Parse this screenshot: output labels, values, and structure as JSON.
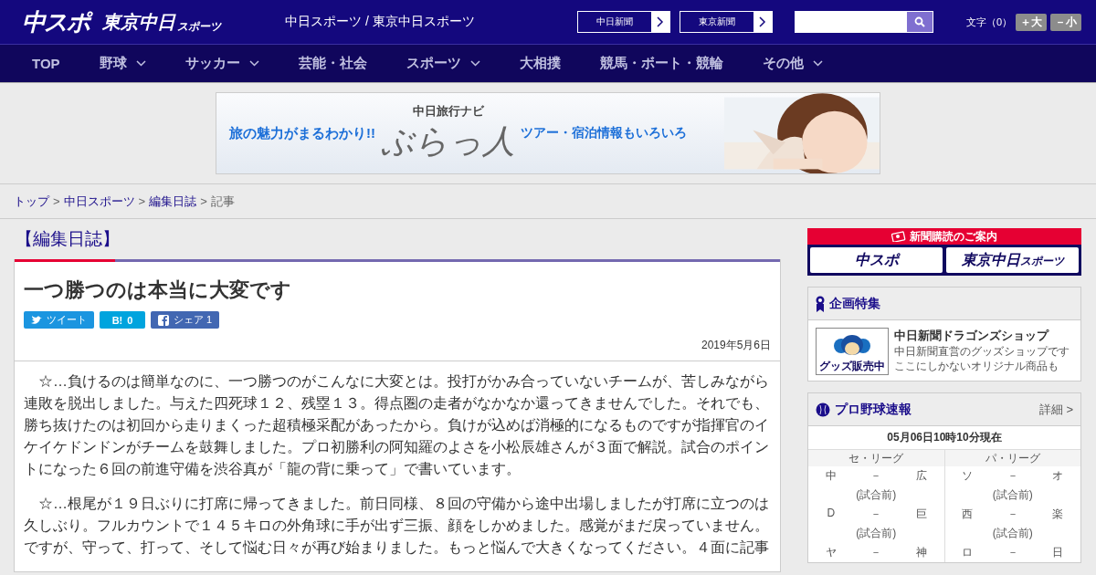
{
  "header": {
    "logo": "中スポ",
    "logo2": "東京中日",
    "logo2_small": "スポーツ",
    "site_names": "中日スポーツ / 東京中日スポーツ",
    "papers": [
      {
        "label": "中日新聞"
      },
      {
        "label": "東京新聞"
      }
    ],
    "font_size": {
      "label": "文字（0）",
      "buttons": [
        "＋大",
        "－小"
      ]
    }
  },
  "nav": [
    {
      "label": "TOP",
      "has_menu": false
    },
    {
      "label": "野球",
      "has_menu": true
    },
    {
      "label": "サッカー",
      "has_menu": true
    },
    {
      "label": "芸能・社会",
      "has_menu": false
    },
    {
      "label": "スポーツ",
      "has_menu": true
    },
    {
      "label": "大相撲",
      "has_menu": false
    },
    {
      "label": "競馬・ボート・競輪",
      "has_menu": false
    },
    {
      "label": "その他",
      "has_menu": true
    }
  ],
  "banner": {
    "lead": "旅の魅力がまるわかり!!",
    "brand_small": "中日旅行ナビ",
    "brand": "ぶらっ人",
    "tail": "ツアー・宿泊情報もいろいろ"
  },
  "breadcrumb": [
    {
      "label": "トップ",
      "link": true
    },
    {
      "sep": ">",
      "label": "中日スポーツ",
      "link": true
    },
    {
      "sep": ">",
      "label": "編集日誌",
      "link": true
    },
    {
      "sep": ">",
      "label": "記事",
      "link": false
    }
  ],
  "section_title": "【編集日誌】",
  "article": {
    "title": "一つ勝つのは本当に大変です",
    "share": [
      {
        "kind": "twitter",
        "label": "ツイート"
      },
      {
        "kind": "hatena",
        "icon_text": "B!",
        "label": "0"
      },
      {
        "kind": "facebook",
        "label": "シェア 1"
      }
    ],
    "date": "2019年5月6日",
    "paragraphs": [
      "☆…負けるのは簡単なのに、一つ勝つのがこんなに大変とは。投打がかみ合っていないチームが、苦しみながら連敗を脱出しました。与えた四死球１２、残塁１３。得点圏の走者がなかなか還ってきませんでした。それでも、勝ち抜けたのは初回から走りまくった超積極采配があったから。負けが込めば消極的になるものですが指揮官のイケイケドンドンがチームを鼓舞しました。プロ初勝利の阿知羅のよさを小松辰雄さんが３面で解説。試合のポイントになった６回の前進守備を渋谷真が「龍の背に乗って」で書いています。",
      "☆…根尾が１９日ぶりに打席に帰ってきました。前日同様、８回の守備から途中出場しましたが打席に立つのは久しぶり。フルカウントで１４５キロの外角球に手が出ず三振、顔をしかめました。感覚がまだ戻っていません。ですが、守って、打って、そして悩む日々が再び始まりました。もっと悩んで大きくなってください。４面に記事"
    ]
  },
  "sidebar": {
    "subscribe": {
      "title": "新聞購読のご案内",
      "logos": [
        "中スポ",
        "東京中日"
      ],
      "logo_small": "スポーツ"
    },
    "feature": {
      "title": "企画特集",
      "item": {
        "badge": "グッズ販売中",
        "name": "中日新聞ドラゴンズショップ",
        "lines": [
          "中日新聞直営のグッズショップです",
          "ここにしかないオリジナル商品も"
        ]
      }
    },
    "baseball": {
      "title": "プロ野球速報",
      "more": "詳細 >",
      "updated": "05月06日10時10分現在",
      "leagues": [
        {
          "name": "セ・リーグ",
          "games": [
            {
              "home": "中",
              "score": "－",
              "away": "広",
              "status": "(試合前)"
            },
            {
              "home": "D",
              "score": "－",
              "away": "巨",
              "status": "(試合前)"
            },
            {
              "home": "ヤ",
              "score": "－",
              "away": "神"
            }
          ]
        },
        {
          "name": "パ・リーグ",
          "games": [
            {
              "home": "ソ",
              "score": "－",
              "away": "オ",
              "status": "(試合前)"
            },
            {
              "home": "西",
              "score": "－",
              "away": "楽",
              "status": "(試合前)"
            },
            {
              "home": "ロ",
              "score": "－",
              "away": "日"
            }
          ]
        }
      ]
    }
  }
}
